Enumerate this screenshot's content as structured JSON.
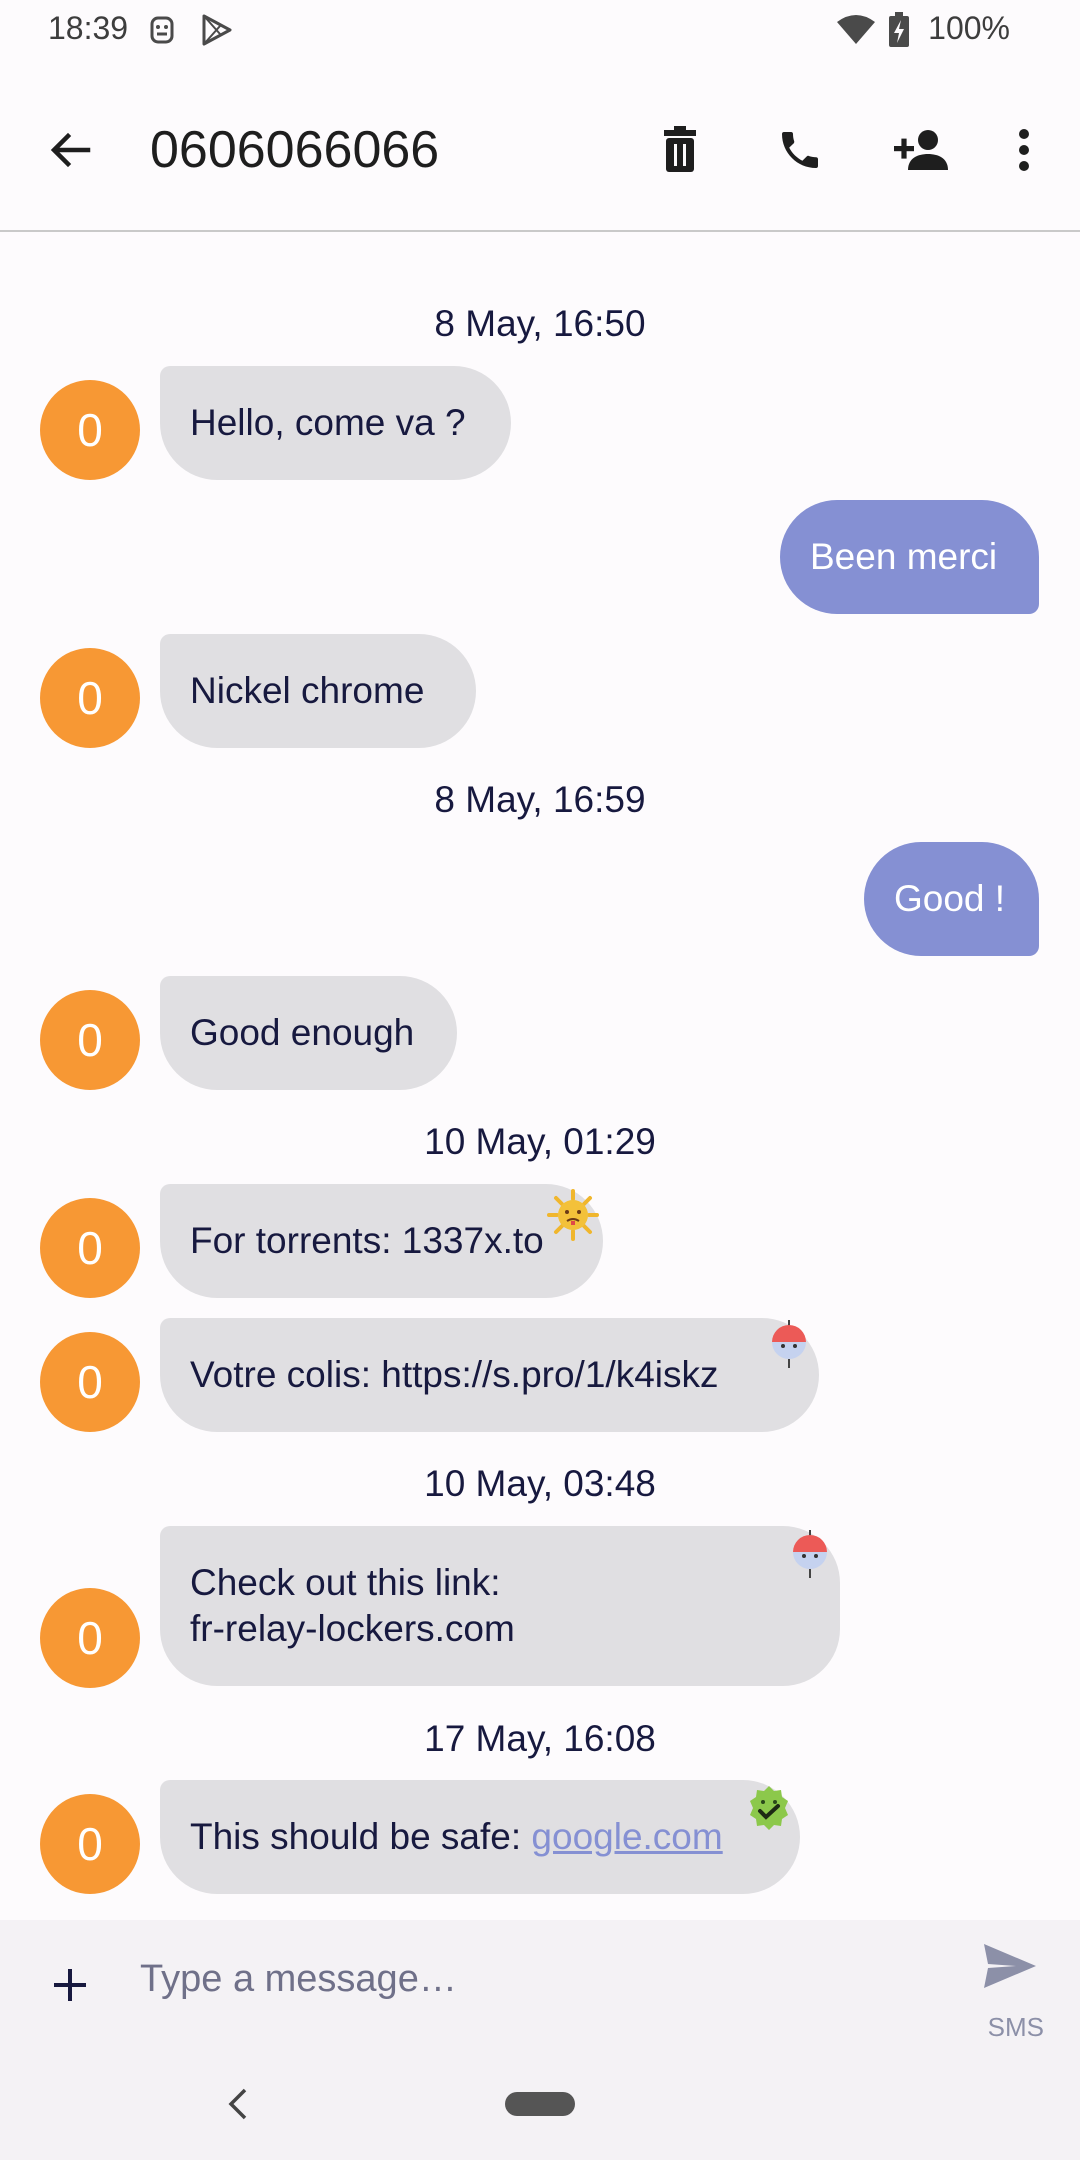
{
  "status": {
    "time": "18:39",
    "battery": "100%"
  },
  "header": {
    "title": "0606066066",
    "icons": [
      "back-arrow-icon",
      "delete-icon",
      "call-icon",
      "add-contact-icon",
      "more-vert-icon"
    ]
  },
  "conversation": {
    "dates": [
      "8 May, 16:50",
      "8 May, 16:59",
      "10 May, 01:29",
      "10 May, 03:48",
      "17 May, 16:08"
    ],
    "avatar_letter": "0",
    "messages": [
      {
        "direction": "in",
        "text": "Hello, come va ?"
      },
      {
        "direction": "out",
        "text": "Been merci"
      },
      {
        "direction": "in",
        "text": "Nickel chrome"
      },
      {
        "direction": "out",
        "text": "Good !"
      },
      {
        "direction": "in",
        "text": "Good enough"
      },
      {
        "direction": "in",
        "text": "For torrents: 1337x.to",
        "badge": "virus-warning-icon"
      },
      {
        "direction": "in",
        "text": "Votre colis: https://s.pro/1/k4iskz",
        "badge": "phishing-bobber-icon"
      },
      {
        "direction": "in",
        "line1": "Check out this link:",
        "line2": "fr-relay-lockers.com",
        "badge": "phishing-bobber-icon"
      },
      {
        "direction": "in",
        "prefix": "This should be safe: ",
        "link": "google.com",
        "badge": "safe-check-icon"
      }
    ]
  },
  "composer": {
    "placeholder": "Type a message…",
    "send_label": "SMS"
  },
  "colors": {
    "incoming_bubble": "#e0dfe2",
    "outgoing_bubble": "#8590d3",
    "avatar": "#f79834"
  }
}
